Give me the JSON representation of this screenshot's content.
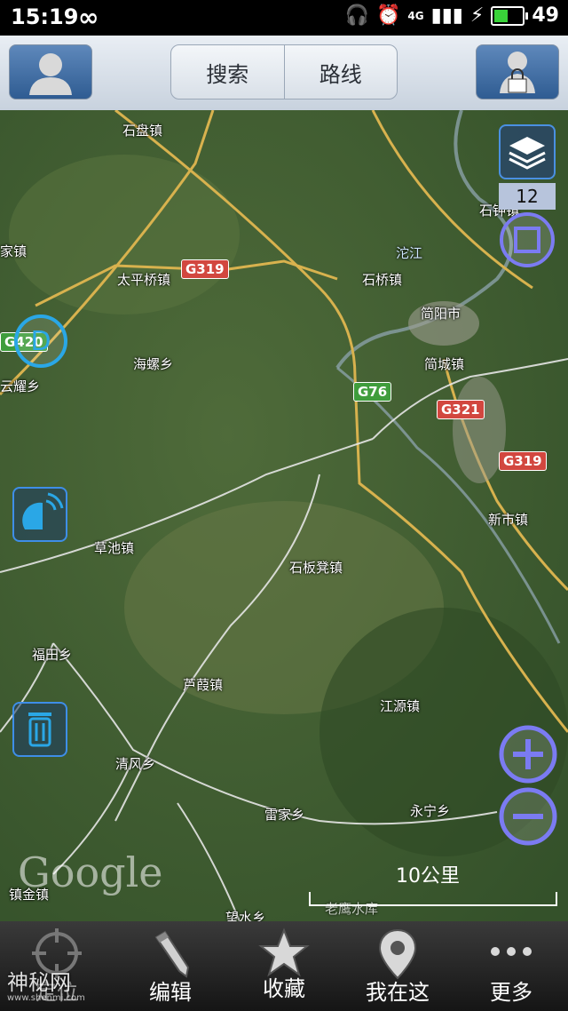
{
  "status_bar": {
    "time": "15:19",
    "battery": "49",
    "battery_level": 0.49,
    "network": "4G",
    "infinity_icon": "infinity-icon"
  },
  "toolbar": {
    "left_button_icon": "user-avatar-icon",
    "tabs": [
      {
        "label": "搜索"
      },
      {
        "label": "路线"
      }
    ],
    "right_button_icon": "user-lock-icon"
  },
  "map": {
    "zoom_level": "12",
    "places": [
      {
        "name": "石盘镇"
      },
      {
        "name": "石钟镇"
      },
      {
        "name": "家镇"
      },
      {
        "name": "太平桥镇"
      },
      {
        "name": "石桥镇"
      },
      {
        "name": "沱江"
      },
      {
        "name": "简阳市"
      },
      {
        "name": "海螺乡"
      },
      {
        "name": "简城镇"
      },
      {
        "name": "云耀乡"
      },
      {
        "name": "新市镇"
      },
      {
        "name": "草池镇"
      },
      {
        "name": "石板凳镇"
      },
      {
        "name": "福田乡"
      },
      {
        "name": "芦葭镇"
      },
      {
        "name": "江源镇"
      },
      {
        "name": "清风乡"
      },
      {
        "name": "雷家乡"
      },
      {
        "name": "永宁乡"
      },
      {
        "name": "镇金镇"
      },
      {
        "name": "望水乡"
      },
      {
        "name": "老鹰水库"
      }
    ],
    "shields": [
      {
        "label": "G319",
        "color": "#d2473f"
      },
      {
        "label": "G76",
        "color": "#3f9d3c"
      },
      {
        "label": "G321",
        "color": "#d2473f"
      },
      {
        "label": "G319",
        "color": "#d2473f"
      },
      {
        "label": "G420",
        "color": "#3f9d3c"
      }
    ],
    "scale": "10公里",
    "logo": "Google"
  },
  "bottom_nav": [
    {
      "label": "定位",
      "icon": "locate-icon"
    },
    {
      "label": "编辑",
      "icon": "pencil-icon"
    },
    {
      "label": "收藏",
      "icon": "star-icon"
    },
    {
      "label": "我在这",
      "icon": "location-pin-icon"
    },
    {
      "label": "更多",
      "icon": "more-dots-icon"
    }
  ],
  "watermark": {
    "text": "神秘网",
    "sub": "www.shenmi.com"
  }
}
